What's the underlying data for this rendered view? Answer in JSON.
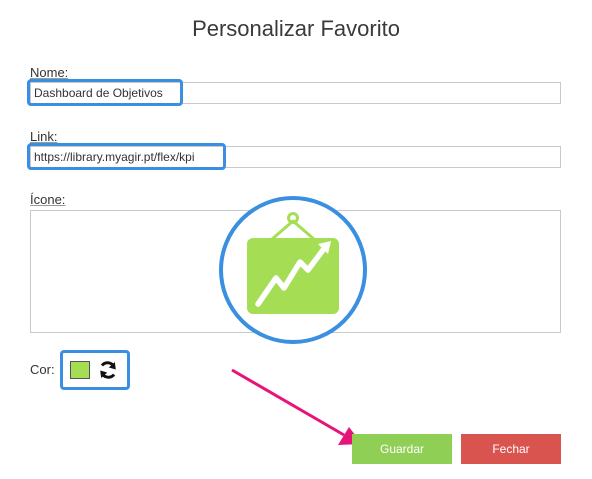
{
  "dialog": {
    "title": "Personalizar Favorito",
    "name_label": "Nome:",
    "name_value": "Dashboard de Objetivos",
    "link_label": "Link:",
    "link_value": "https://library.myagir.pt/flex/kpi",
    "icon_label": "Ícone:",
    "selected_icon": "chart-line-board-icon",
    "color_label": "Cor:",
    "color_value": "#a5de55",
    "refresh_icon": "refresh-icon",
    "save_label": "Guardar",
    "close_label": "Fechar"
  },
  "colors": {
    "highlight": "#3b8fe0",
    "save_button": "#8fcf55",
    "close_button": "#d9534f",
    "arrow": "#e8137a"
  }
}
